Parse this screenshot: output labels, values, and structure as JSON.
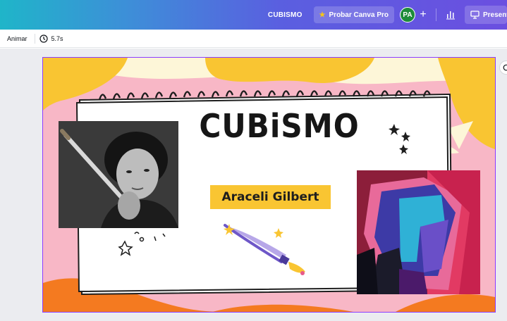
{
  "topbar": {
    "doc_title": "CUBISMO",
    "try_pro_label": "Probar Canva Pro",
    "avatar_initials": "PA",
    "plus_label": "+",
    "present_label": "Presentar",
    "colors": {
      "gradient_start": "#1fb5c9",
      "gradient_end": "#6b4fe0",
      "avatar_bg": "#1e8b3a",
      "star": "#f5c518"
    }
  },
  "subbar": {
    "animate_label": "Animar",
    "duration_label": "5.7s"
  },
  "slide": {
    "title": "CUBiSMO",
    "name": "Araceli Gilbert",
    "colors": {
      "background_pink": "#f8b7c6",
      "blob_yellow": "#f9c532",
      "cream": "#fdf6d8",
      "orange": "#f47a20",
      "name_label": "#f9c532",
      "selection": "#8b3dff"
    }
  },
  "icons": [
    "clock-icon",
    "chart-icon",
    "present-icon",
    "star-icon",
    "comment-icon",
    "spiral-binding",
    "paintbrush-icon",
    "sparkle-icon"
  ]
}
